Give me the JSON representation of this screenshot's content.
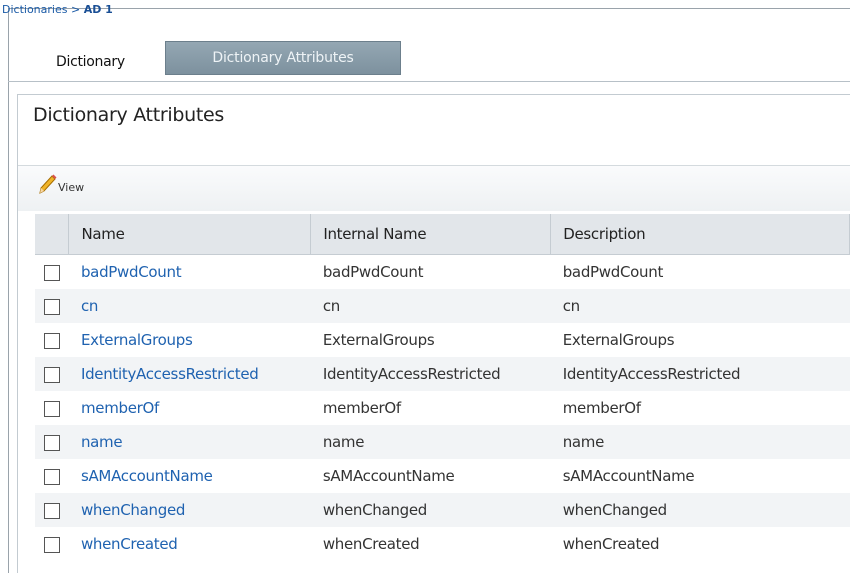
{
  "breadcrumb": {
    "parent": "Dictionaries",
    "separator": " > ",
    "current": "AD 1"
  },
  "tabs": {
    "dictionary": "Dictionary",
    "attributes": "Dictionary Attributes"
  },
  "section": {
    "title": "Dictionary Attributes"
  },
  "toolbar": {
    "view_label": "View",
    "icon": "pencil-icon"
  },
  "table": {
    "columns": [
      "Name",
      "Internal Name",
      "Description"
    ],
    "rows": [
      {
        "name": "badPwdCount",
        "internal": "badPwdCount",
        "description": "badPwdCount"
      },
      {
        "name": "cn",
        "internal": "cn",
        "description": "cn"
      },
      {
        "name": "ExternalGroups",
        "internal": "ExternalGroups",
        "description": "ExternalGroups"
      },
      {
        "name": "IdentityAccessRestricted",
        "internal": "IdentityAccessRestricted",
        "description": "IdentityAccessRestricted"
      },
      {
        "name": "memberOf",
        "internal": "memberOf",
        "description": "memberOf"
      },
      {
        "name": "name",
        "internal": "name",
        "description": "name"
      },
      {
        "name": "sAMAccountName",
        "internal": "sAMAccountName",
        "description": "sAMAccountName"
      },
      {
        "name": "whenChanged",
        "internal": "whenChanged",
        "description": "whenChanged"
      },
      {
        "name": "whenCreated",
        "internal": "whenCreated",
        "description": "whenCreated"
      }
    ]
  },
  "colors": {
    "link": "#1f62b0",
    "active_tab": "#8499a6",
    "header_bg": "#e2e6ea"
  }
}
